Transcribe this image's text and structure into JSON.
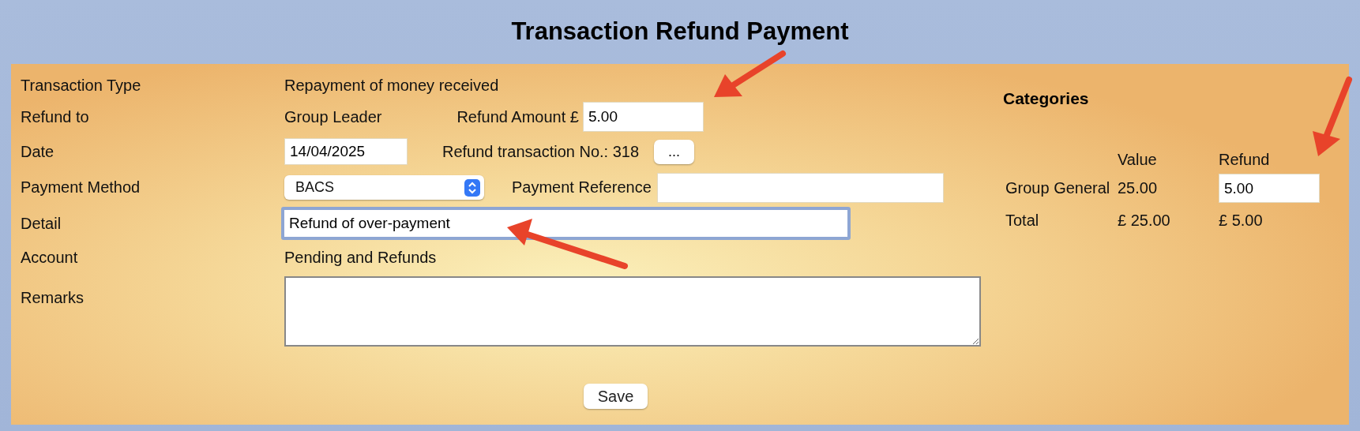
{
  "title": "Transaction Refund Payment",
  "form": {
    "rows": [
      {
        "label": "Transaction Type",
        "kind": "text",
        "value": "Repayment of money received"
      },
      {
        "label": "Refund to",
        "kind": "text",
        "value": "Group Leader",
        "extra": {
          "kind": "input",
          "label": "Refund Amount £",
          "value": "5.00"
        }
      },
      {
        "label": "Date",
        "kind": "input",
        "value": "14/04/2025",
        "extra": {
          "kind": "button",
          "label": "Refund transaction No.: 318",
          "button": "..."
        }
      },
      {
        "label": "Payment Method",
        "kind": "select",
        "value": "BACS",
        "extra": {
          "kind": "input",
          "label": "Payment Reference"
        }
      },
      {
        "label": "Detail",
        "kind": "input",
        "value": "Refund of over-payment",
        "focused": true
      },
      {
        "label": "Account",
        "kind": "text",
        "value": "Pending and Refunds"
      },
      {
        "label": "Remarks",
        "kind": "textarea"
      }
    ]
  },
  "categories": {
    "title": "Categories",
    "columns": [
      "Value",
      "Refund"
    ],
    "rows": [
      {
        "name": "Group General",
        "value": "25.00",
        "refund": "5.00"
      }
    ],
    "total": {
      "label": "Total",
      "value": "£ 25.00",
      "refund": "£ 5.00"
    }
  },
  "save": "Save"
}
